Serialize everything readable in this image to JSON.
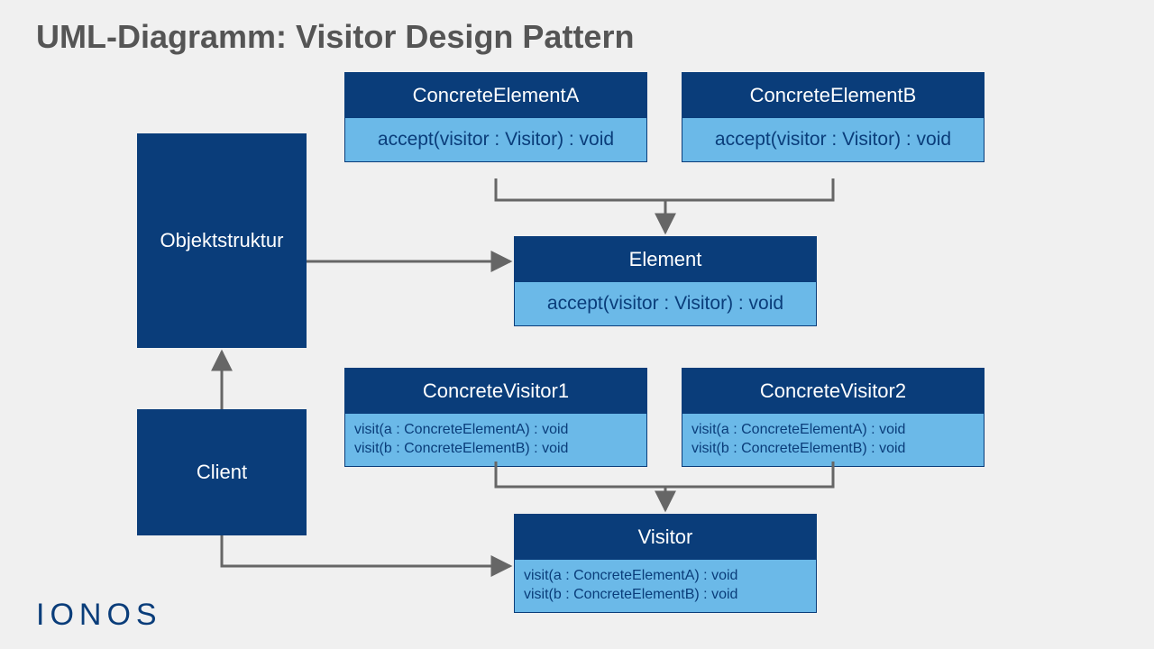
{
  "title": "UML-Diagramm: Visitor Design Pattern",
  "logo": "IONOS",
  "nodes": {
    "objektstruktur": {
      "label": "Objektstruktur"
    },
    "client": {
      "label": "Client"
    },
    "concreteElementA": {
      "name": "ConcreteElementA",
      "method": "accept(visitor : Visitor) : void"
    },
    "concreteElementB": {
      "name": "ConcreteElementB",
      "method": "accept(visitor : Visitor) : void"
    },
    "element": {
      "name": "Element",
      "method": "accept(visitor : Visitor) : void"
    },
    "concreteVisitor1": {
      "name": "ConcreteVisitor1",
      "method1": "visit(a : ConcreteElementA) : void",
      "method2": "visit(b : ConcreteElementB) : void"
    },
    "concreteVisitor2": {
      "name": "ConcreteVisitor2",
      "method1": "visit(a : ConcreteElementA) : void",
      "method2": "visit(b : ConcreteElementB) : void"
    },
    "visitor": {
      "name": "Visitor",
      "method1": "visit(a : ConcreteElementA) : void",
      "method2": "visit(b : ConcreteElementB) : void"
    }
  },
  "diagram": {
    "type": "uml-class",
    "edges": [
      {
        "from": "ConcreteElementA",
        "to": "Element",
        "kind": "generalization"
      },
      {
        "from": "ConcreteElementB",
        "to": "Element",
        "kind": "generalization"
      },
      {
        "from": "ConcreteVisitor1",
        "to": "Visitor",
        "kind": "generalization"
      },
      {
        "from": "ConcreteVisitor2",
        "to": "Visitor",
        "kind": "generalization"
      },
      {
        "from": "Objektstruktur",
        "to": "Element",
        "kind": "association"
      },
      {
        "from": "Client",
        "to": "Objektstruktur",
        "kind": "association"
      },
      {
        "from": "Client",
        "to": "Visitor",
        "kind": "association"
      }
    ]
  }
}
